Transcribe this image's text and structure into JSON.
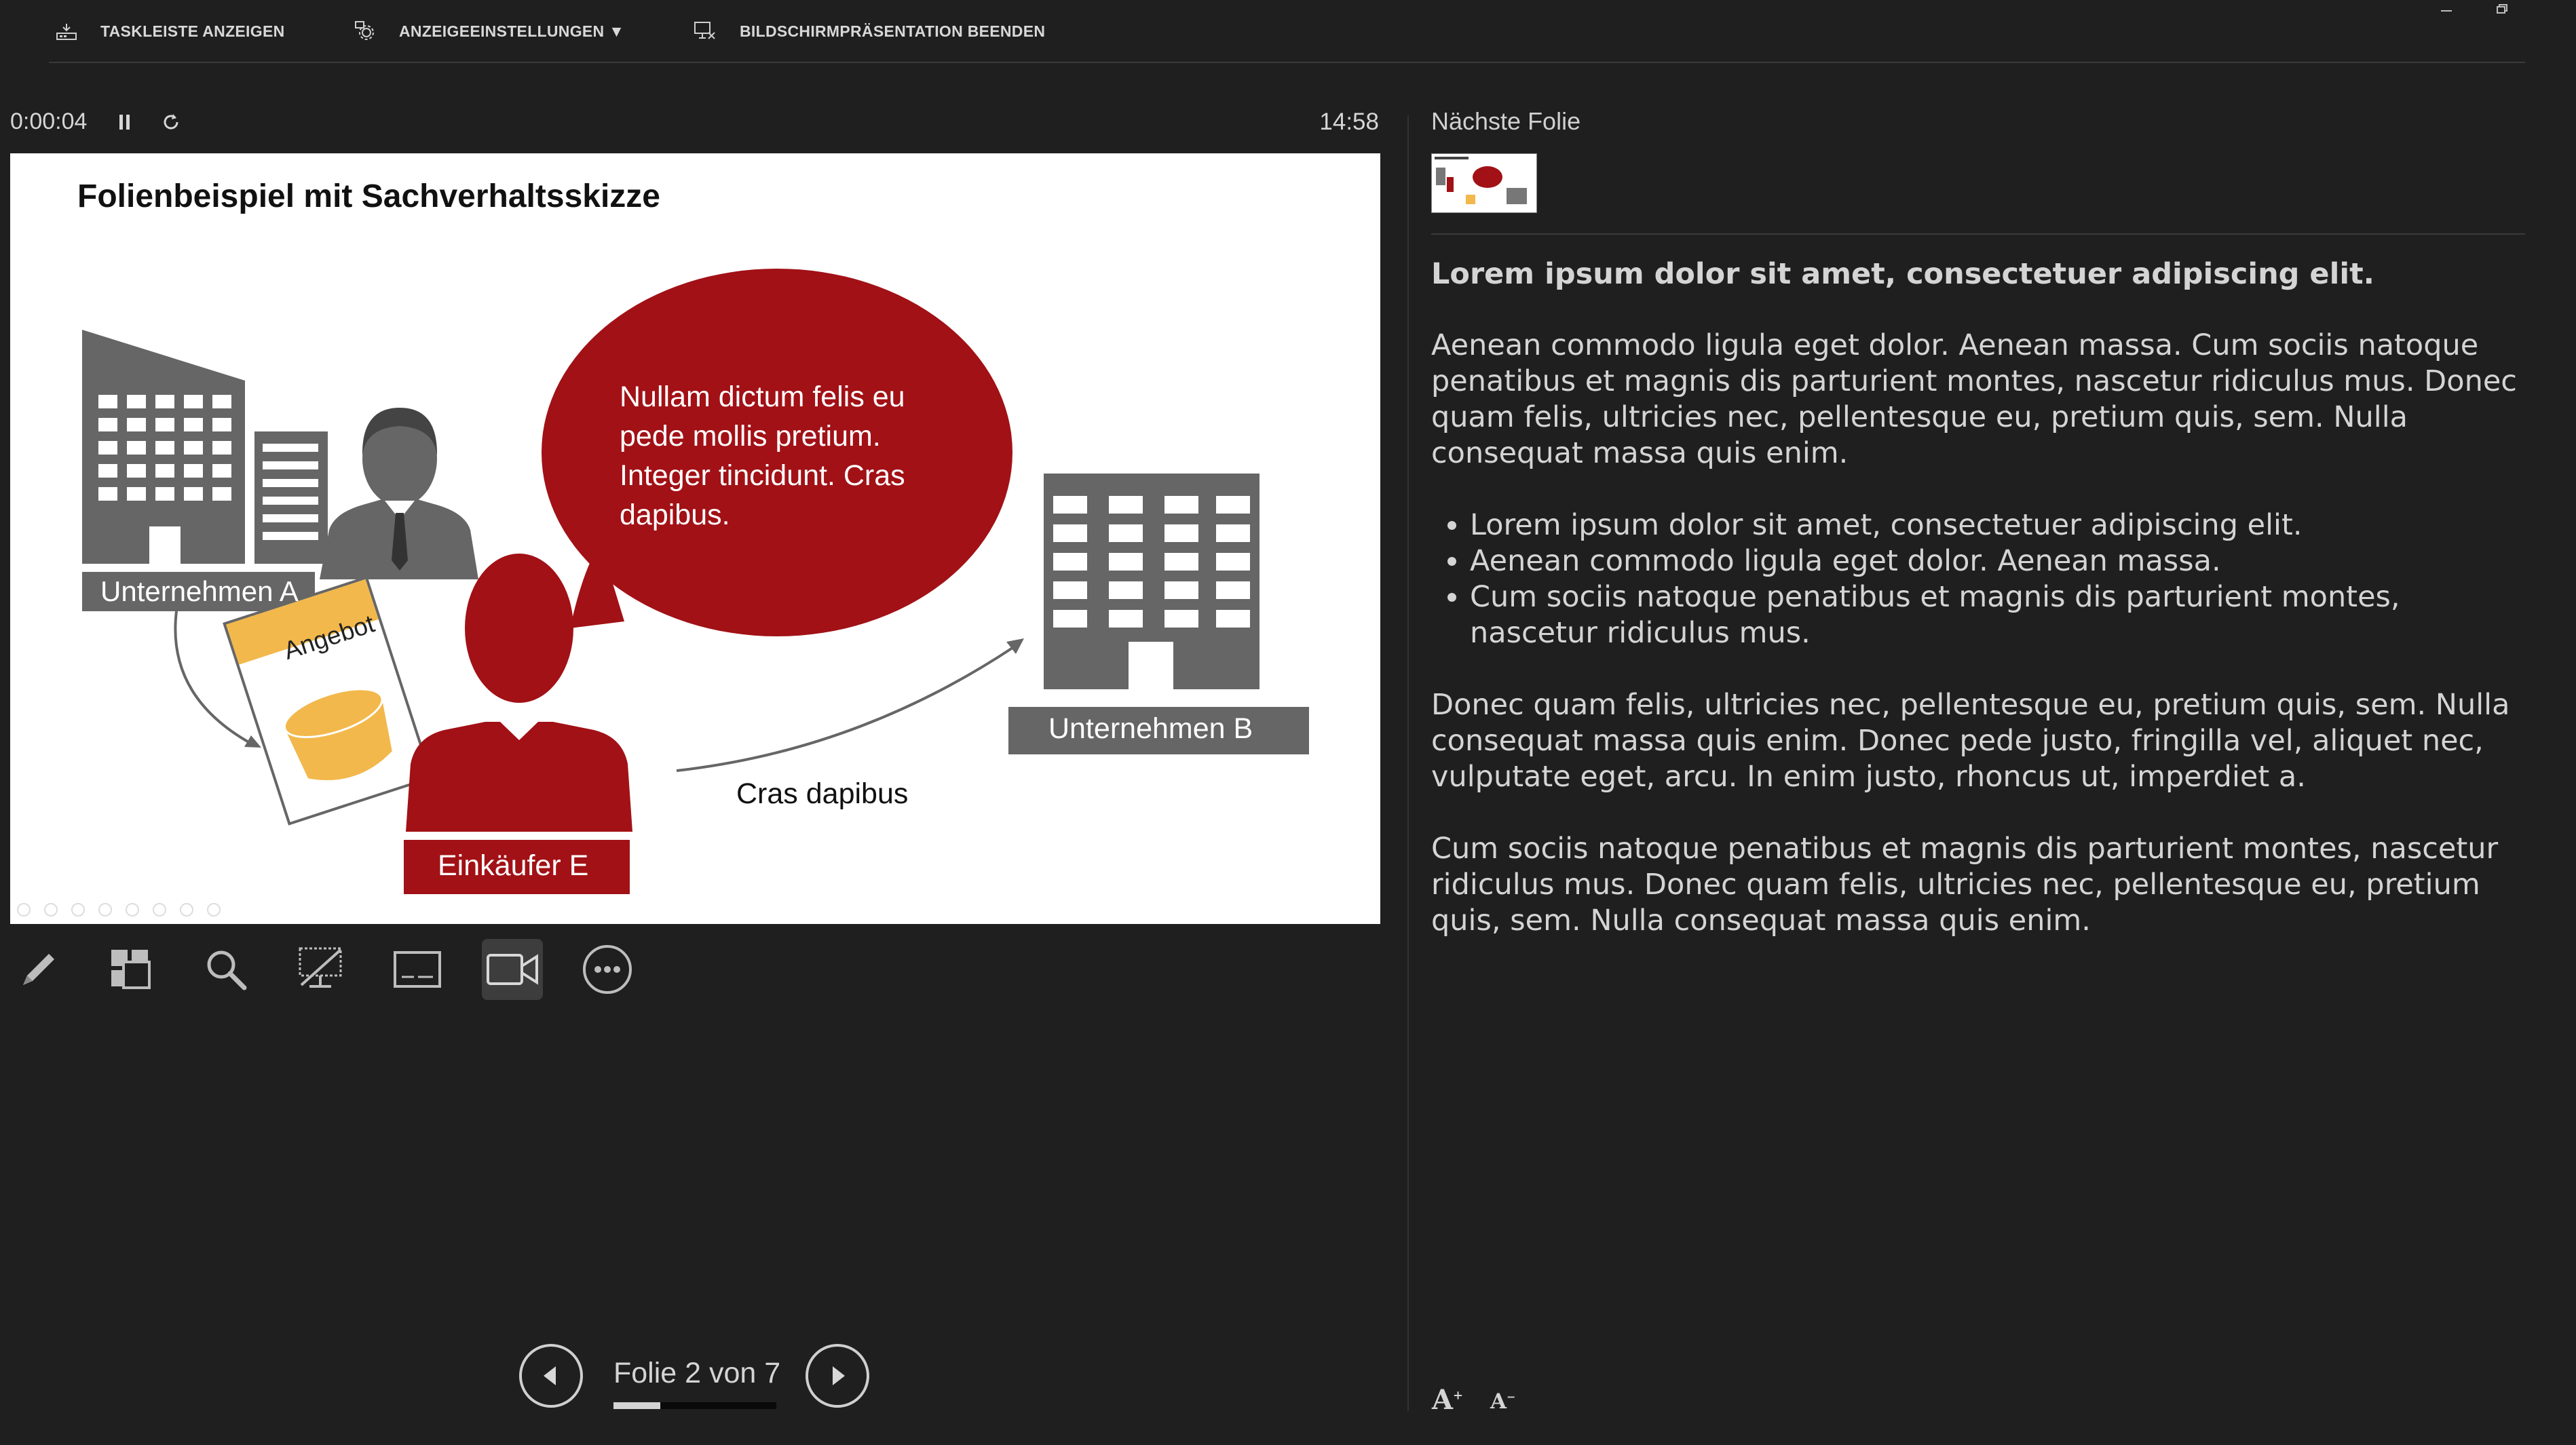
{
  "toolbar": {
    "taskbar_label": "TASKLEISTE ANZEIGEN",
    "display_settings_label": "ANZEIGEEINSTELLUNGEN ▼",
    "end_show_label": "BILDSCHIRMPRÄSENTATION BEENDEN"
  },
  "timer": {
    "elapsed": "0:00:04",
    "clock": "14:58"
  },
  "slide": {
    "title": "Folienbeispiel mit Sachverhaltsskizze",
    "bubble_text": "Nullam dictum felis eu pede mollis pretium. Integer tincidunt. Cras dapibus.",
    "company_a": "Unternehmen A",
    "company_b": "Unternehmen B",
    "offer": "Angebot",
    "buyer": "Einkäufer E",
    "arrow_label": "Cras dapibus"
  },
  "tools": [
    "pen-icon",
    "all-slides-icon",
    "zoom-icon",
    "black-screen-icon",
    "subtitles-icon",
    "camera-icon",
    "more-options-icon"
  ],
  "navigation": {
    "counter": "Folie 2 von 7",
    "progress": 0.2857
  },
  "next_slide": {
    "label": "Nächste Folie"
  },
  "notes": {
    "heading": "Lorem ipsum dolor sit amet, consectetuer adipiscing elit.",
    "paragraph1": "Aenean commodo ligula eget dolor. Aenean massa. Cum sociis natoque penatibus et magnis dis parturient montes, nascetur ridiculus mus. Donec quam felis, ultricies nec, pellentesque eu, pretium quis, sem. Nulla consequat massa quis enim.",
    "bullets": [
      "Lorem ipsum dolor sit amet, consectetuer adipiscing elit.",
      "Aenean commodo ligula eget dolor. Aenean massa.",
      "Cum sociis natoque penatibus et magnis dis parturient montes, nascetur ridiculus mus."
    ],
    "paragraph2": "Donec quam felis, ultricies nec, pellentesque eu, pretium quis, sem. Nulla consequat massa quis enim. Donec pede justo, fringilla vel, aliquet nec, vulputate eget, arcu. In enim justo, rhoncus ut, imperdiet a.",
    "paragraph3": "Cum sociis natoque penatibus et magnis dis parturient montes, nascetur ridiculus mus. Donec quam felis, ultricies nec, pellentesque eu, pretium quis, sem. Nulla consequat massa quis enim."
  },
  "font_controls": {
    "increase": "A",
    "decrease": "A"
  },
  "colors": {
    "background": "#1f1f1f",
    "accent_red": "#a11116",
    "building_gray": "#666666",
    "offer_yellow": "#f2b84b"
  }
}
